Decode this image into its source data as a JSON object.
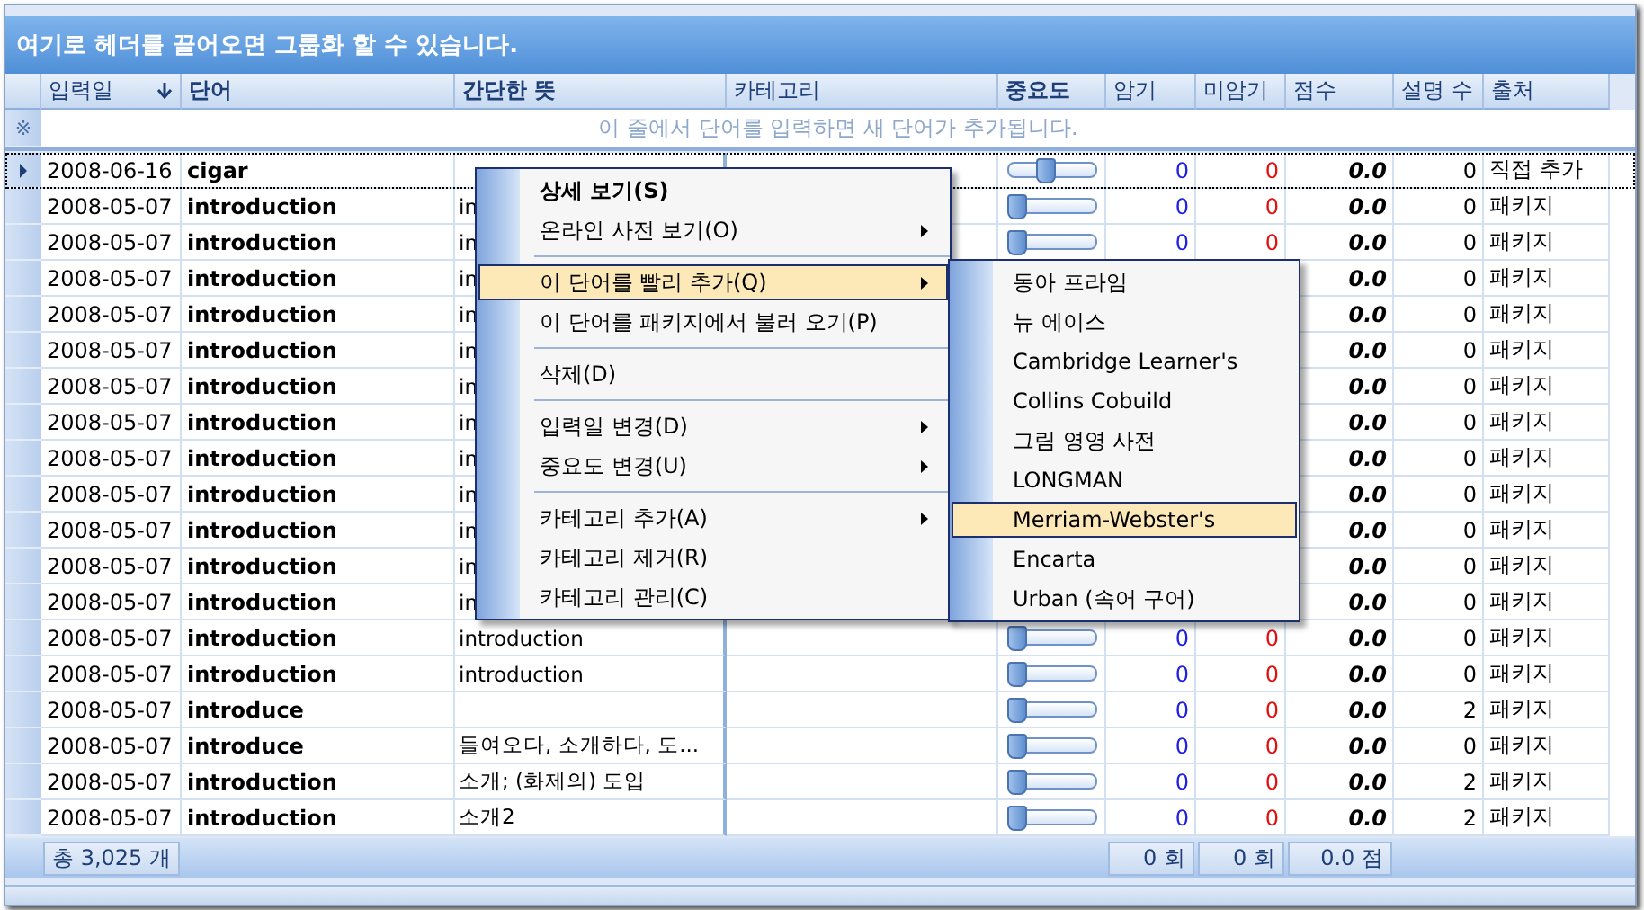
{
  "group_panel": {
    "text": "여기로 헤더를 끌어오면 그룹화 할 수 있습니다."
  },
  "columns": [
    {
      "label": "입력일",
      "sorted": true,
      "bold": false
    },
    {
      "label": "단어",
      "sorted": false,
      "bold": true
    },
    {
      "label": "간단한 뜻",
      "sorted": false,
      "bold": true
    },
    {
      "label": "카테고리",
      "sorted": false,
      "bold": false
    },
    {
      "label": "중요도",
      "sorted": false,
      "bold": true
    },
    {
      "label": "암기",
      "sorted": false,
      "bold": false
    },
    {
      "label": "미암기",
      "sorted": false,
      "bold": false
    },
    {
      "label": "점수",
      "sorted": false,
      "bold": false
    },
    {
      "label": "설명 수",
      "sorted": false,
      "bold": false
    },
    {
      "label": "출처",
      "sorted": false,
      "bold": false
    }
  ],
  "new_row": {
    "marker": "※",
    "hint": "이 줄에서 단어를 입력하면 새 단어가 추가됩니다."
  },
  "rows": [
    {
      "selected": true,
      "date": "2008-06-16",
      "word": "cigar",
      "importance": {
        "level": 0.4
      },
      "memorized": "0",
      "unmemorized": "0",
      "score": "0.0",
      "explanations": "0",
      "source": "직접 추가"
    },
    {
      "selected": false,
      "date": "2008-05-07",
      "word": "introduction",
      "meaning": "in",
      "importance": {
        "level": 0
      },
      "memorized": "0",
      "unmemorized": "0",
      "score": "0.0",
      "explanations": "0",
      "source": "패키지"
    },
    {
      "selected": false,
      "date": "2008-05-07",
      "word": "introduction",
      "meaning": "in",
      "importance": {
        "level": 0
      },
      "memorized": "0",
      "unmemorized": "0",
      "score": "0.0",
      "explanations": "0",
      "source": "패키지"
    },
    {
      "selected": false,
      "date": "2008-05-07",
      "word": "introduction",
      "meaning": "in",
      "score": "0.0",
      "explanations": "0",
      "source": "패키지"
    },
    {
      "selected": false,
      "date": "2008-05-07",
      "word": "introduction",
      "meaning": "in",
      "score": "0.0",
      "explanations": "0",
      "source": "패키지"
    },
    {
      "selected": false,
      "date": "2008-05-07",
      "word": "introduction",
      "meaning": "in",
      "score": "0.0",
      "explanations": "0",
      "source": "패키지"
    },
    {
      "selected": false,
      "date": "2008-05-07",
      "word": "introduction",
      "meaning": "in",
      "score": "0.0",
      "explanations": "0",
      "source": "패키지"
    },
    {
      "selected": false,
      "date": "2008-05-07",
      "word": "introduction",
      "meaning": "in",
      "score": "0.0",
      "explanations": "0",
      "source": "패키지"
    },
    {
      "selected": false,
      "date": "2008-05-07",
      "word": "introduction",
      "meaning": "in",
      "score": "0.0",
      "explanations": "0",
      "source": "패키지"
    },
    {
      "selected": false,
      "date": "2008-05-07",
      "word": "introduction",
      "meaning": "in",
      "score": "0.0",
      "explanations": "0",
      "source": "패키지"
    },
    {
      "selected": false,
      "date": "2008-05-07",
      "word": "introduction",
      "meaning": "in",
      "score": "0.0",
      "explanations": "0",
      "source": "패키지"
    },
    {
      "selected": false,
      "date": "2008-05-07",
      "word": "introduction",
      "meaning": "in",
      "score": "0.0",
      "explanations": "0",
      "source": "패키지"
    },
    {
      "selected": false,
      "date": "2008-05-07",
      "word": "introduction",
      "meaning": "in",
      "score": "0.0",
      "explanations": "0",
      "source": "패키지"
    },
    {
      "selected": false,
      "date": "2008-05-07",
      "word": "introduction",
      "meaning": "introduction",
      "importance": {
        "level": 0
      },
      "memorized": "0",
      "unmemorized": "0",
      "score": "0.0",
      "explanations": "0",
      "source": "패키지"
    },
    {
      "selected": false,
      "date": "2008-05-07",
      "word": "introduction",
      "meaning": "introduction",
      "importance": {
        "level": 0
      },
      "memorized": "0",
      "unmemorized": "0",
      "score": "0.0",
      "explanations": "0",
      "source": "패키지"
    },
    {
      "selected": false,
      "date": "2008-05-07",
      "word": "introduce",
      "importance": {
        "level": 0
      },
      "memorized": "0",
      "unmemorized": "0",
      "score": "0.0",
      "explanations": "2",
      "source": "패키지"
    },
    {
      "selected": false,
      "date": "2008-05-07",
      "word": "introduce",
      "meaning": "들여오다, 소개하다, 도...",
      "importance": {
        "level": 0
      },
      "memorized": "0",
      "unmemorized": "0",
      "score": "0.0",
      "explanations": "0",
      "source": "패키지"
    },
    {
      "selected": false,
      "date": "2008-05-07",
      "word": "introduction",
      "meaning": "소개; (화제의) 도입",
      "importance": {
        "level": 0
      },
      "memorized": "0",
      "unmemorized": "0",
      "score": "0.0",
      "explanations": "2",
      "source": "패키지"
    },
    {
      "selected": false,
      "date": "2008-05-07",
      "word": "introduction",
      "meaning": "소개2",
      "importance": {
        "level": 0
      },
      "memorized": "0",
      "unmemorized": "0",
      "score": "0.0",
      "explanations": "2",
      "source": "패키지"
    }
  ],
  "footer": {
    "total": "총 3,025 개",
    "memorized": "0 회",
    "unmemorized": "0 회",
    "score": "0.0 점"
  },
  "context_menu": [
    {
      "kind": "item",
      "label": "상세 보기(S)",
      "bold": true,
      "submenu": false,
      "selected": false
    },
    {
      "kind": "item",
      "label": "온라인 사전 보기(O)",
      "bold": false,
      "submenu": true,
      "selected": false
    },
    {
      "kind": "separator"
    },
    {
      "kind": "item",
      "label": "이 단어를 빨리 추가(Q)",
      "bold": false,
      "submenu": true,
      "selected": true
    },
    {
      "kind": "item",
      "label": "이 단어를 패키지에서 불러 오기(P)",
      "bold": false,
      "submenu": false,
      "selected": false
    },
    {
      "kind": "separator"
    },
    {
      "kind": "item",
      "label": "삭제(D)",
      "bold": false,
      "submenu": false,
      "selected": false
    },
    {
      "kind": "separator"
    },
    {
      "kind": "item",
      "label": "입력일 변경(D)",
      "bold": false,
      "submenu": true,
      "selected": false
    },
    {
      "kind": "item",
      "label": "중요도 변경(U)",
      "bold": false,
      "submenu": true,
      "selected": false
    },
    {
      "kind": "separator"
    },
    {
      "kind": "item",
      "label": "카테고리 추가(A)",
      "bold": false,
      "submenu": true,
      "selected": false
    },
    {
      "kind": "item",
      "label": "카테고리 제거(R)",
      "bold": false,
      "submenu": false,
      "selected": false
    },
    {
      "kind": "item",
      "label": "카테고리 관리(C)",
      "bold": false,
      "submenu": false,
      "selected": false
    }
  ],
  "submenu": [
    {
      "label": "동아 프라임",
      "selected": false
    },
    {
      "label": "뉴 에이스",
      "selected": false
    },
    {
      "label": "Cambridge Learner's",
      "selected": false
    },
    {
      "label": "Collins Cobuild",
      "selected": false
    },
    {
      "label": "그림 영영 사전",
      "selected": false
    },
    {
      "label": "LONGMAN",
      "selected": false
    },
    {
      "label": "Merriam-Webster's",
      "selected": true
    },
    {
      "label": "Encarta",
      "selected": false
    },
    {
      "label": "Urban (속어 구어)",
      "selected": false
    }
  ]
}
